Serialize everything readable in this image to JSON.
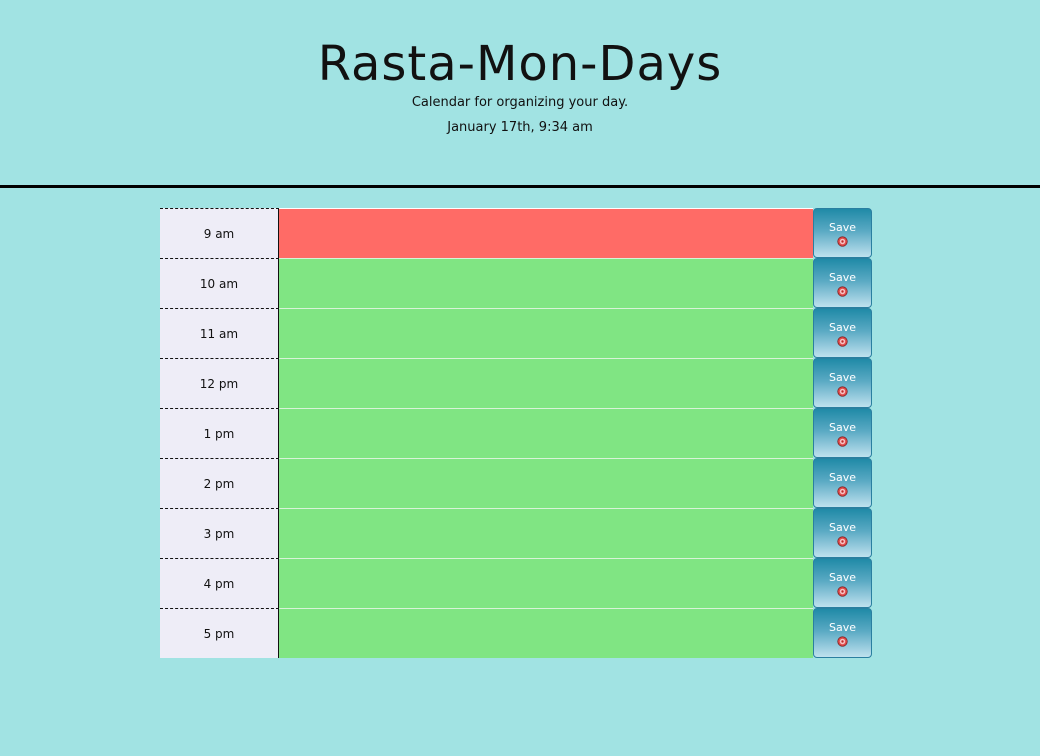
{
  "header": {
    "title": "Rasta-Mon-Days",
    "lead": "Calendar for organizing your day.",
    "current_day": "January 17th, 9:34 am"
  },
  "colors": {
    "background": "#a1e3e3",
    "present": "#ff6b66",
    "future": "#80e583",
    "hour_cell": "#eeedf7",
    "save_button": "#208aa7"
  },
  "timeblocks": [
    {
      "hour": "9 am",
      "state": "present",
      "text": "",
      "save_label": "Save",
      "save_icon": "floppy-disk-icon"
    },
    {
      "hour": "10 am",
      "state": "future",
      "text": "",
      "save_label": "Save",
      "save_icon": "floppy-disk-icon"
    },
    {
      "hour": "11 am",
      "state": "future",
      "text": "",
      "save_label": "Save",
      "save_icon": "floppy-disk-icon"
    },
    {
      "hour": "12 pm",
      "state": "future",
      "text": "",
      "save_label": "Save",
      "save_icon": "floppy-disk-icon"
    },
    {
      "hour": "1 pm",
      "state": "future",
      "text": "",
      "save_label": "Save",
      "save_icon": "floppy-disk-icon"
    },
    {
      "hour": "2 pm",
      "state": "future",
      "text": "",
      "save_label": "Save",
      "save_icon": "floppy-disk-icon"
    },
    {
      "hour": "3 pm",
      "state": "future",
      "text": "",
      "save_label": "Save",
      "save_icon": "floppy-disk-icon"
    },
    {
      "hour": "4 pm",
      "state": "future",
      "text": "",
      "save_label": "Save",
      "save_icon": "floppy-disk-icon"
    },
    {
      "hour": "5 pm",
      "state": "future",
      "text": "",
      "save_label": "Save",
      "save_icon": "floppy-disk-icon"
    }
  ]
}
